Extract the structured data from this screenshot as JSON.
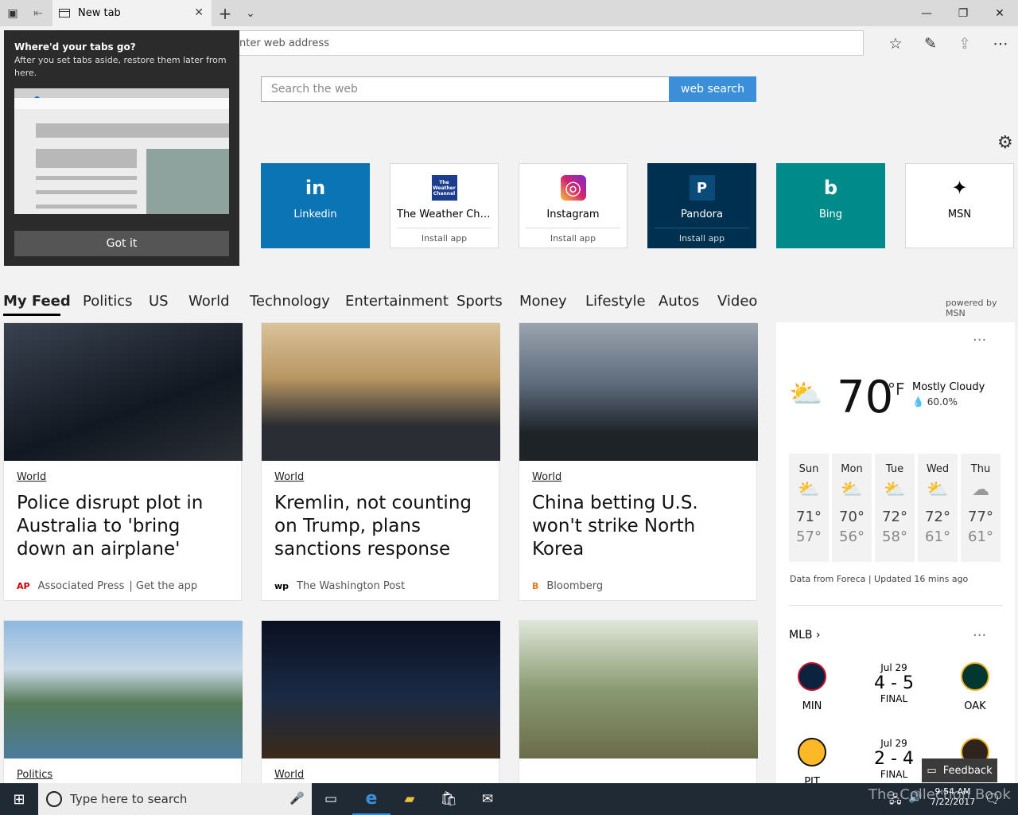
{
  "tabbar": {
    "tab_title": "New tab",
    "set_aside_icon": "set-aside-icon",
    "restore_icon": "restore-tabs-icon",
    "add_icon": "+",
    "chevron": "⌄",
    "close": "✕",
    "win_min": "—",
    "win_max": "❐",
    "win_close": "✕"
  },
  "address": {
    "placeholder": "nter web address"
  },
  "toolbar": {
    "favorites": "☆",
    "notes": "✎",
    "share": "⇪",
    "more": "⋯"
  },
  "search": {
    "placeholder": "Search the web",
    "button": "web search"
  },
  "flyout": {
    "title": "Where'd your tabs go?",
    "body": "After you set tabs aside, restore them later from here.",
    "button": "Got it"
  },
  "tiles": [
    {
      "label": "Linkedin",
      "install": "",
      "bg": "#0a74b5",
      "color": "#fff",
      "icon": "in"
    },
    {
      "label": "The Weather Cha...",
      "install": "Install app",
      "bg": "#fff",
      "color": "#000",
      "icon": "The Weather Channel"
    },
    {
      "label": "Instagram",
      "install": "Install app",
      "bg": "#fff",
      "color": "#000",
      "icon": "◎"
    },
    {
      "label": "Pandora",
      "install": "Install app",
      "bg": "#00304f",
      "color": "#fff",
      "icon": "P"
    },
    {
      "label": "Bing",
      "install": "",
      "bg": "#008b8b",
      "color": "#fff",
      "icon": "b"
    },
    {
      "label": "MSN",
      "install": "",
      "bg": "#fff",
      "color": "#000",
      "icon": "✦"
    }
  ],
  "nav": {
    "items": [
      "My Feed",
      "Politics",
      "US",
      "World",
      "Technology",
      "Entertainment",
      "Sports",
      "Money",
      "Lifestyle",
      "Autos",
      "Video"
    ],
    "powered": "powered by MSN"
  },
  "cards": [
    {
      "cat": "World",
      "title": "Police disrupt plot in Australia to 'bring down an airplane'",
      "src": "Associated Press",
      "extra": "| Get the app",
      "srcicon": "AP",
      "srccolor": "#c00",
      "imgbg": "linear-gradient(160deg,#3a4250,#111821 60%,#2b2f36)"
    },
    {
      "cat": "World",
      "title": "Kremlin, not counting on Trump, plans sanctions response",
      "src": "The Washington Post",
      "extra": "",
      "srcicon": "wp",
      "srccolor": "#000",
      "imgbg": "linear-gradient(180deg,#d9c39a,#b89662 40%,#2a2d33 75%)"
    },
    {
      "cat": "World",
      "title": "China betting U.S. won't strike North Korea",
      "src": "Bloomberg",
      "extra": "",
      "srcicon": "B",
      "srccolor": "#e87722",
      "imgbg": "linear-gradient(180deg,#9aa3ae,#5c6a7a 45%,#1e2328 80%)"
    },
    {
      "cat": "Politics",
      "imgbg": "linear-gradient(180deg,#8fb8e0,#c7d8e6 35%,#567a58 60%,#4b7b9c)"
    },
    {
      "cat": "World",
      "imgbg": "linear-gradient(180deg,#0a1020,#1a2a45 55%,#3b2a1a)"
    },
    {
      "cat": "",
      "imgbg": "linear-gradient(180deg,#dfe7d8,#8a9a72 50%,#6b6b4a)"
    }
  ],
  "weather": {
    "temp": "70",
    "unit": "°F",
    "cond": "Mostly Cloudy",
    "precip": "60.0%",
    "more": "···",
    "source": "Data from Foreca | Updated 16 mins ago",
    "days": [
      {
        "d": "Sun",
        "hi": "71°",
        "lo": "57°"
      },
      {
        "d": "Mon",
        "hi": "70°",
        "lo": "56°"
      },
      {
        "d": "Tue",
        "hi": "72°",
        "lo": "58°"
      },
      {
        "d": "Wed",
        "hi": "72°",
        "lo": "61°"
      },
      {
        "d": "Thu",
        "hi": "77°",
        "lo": "61°"
      }
    ]
  },
  "mlb": {
    "title": "MLB",
    "more": "···",
    "games": [
      {
        "date": "Jul 29",
        "score": "4 - 5",
        "status": "FINAL",
        "home": "MIN",
        "away": "OAK"
      },
      {
        "date": "Jul 29",
        "score": "2 - 4",
        "status": "FINAL",
        "home": "PIT",
        "away": ""
      }
    ]
  },
  "feedback": "Feedback",
  "taskbar": {
    "search": "Type here to search",
    "time": "9:54 AM",
    "date": "7/22/2017",
    "watermark": "The Collection Book"
  }
}
